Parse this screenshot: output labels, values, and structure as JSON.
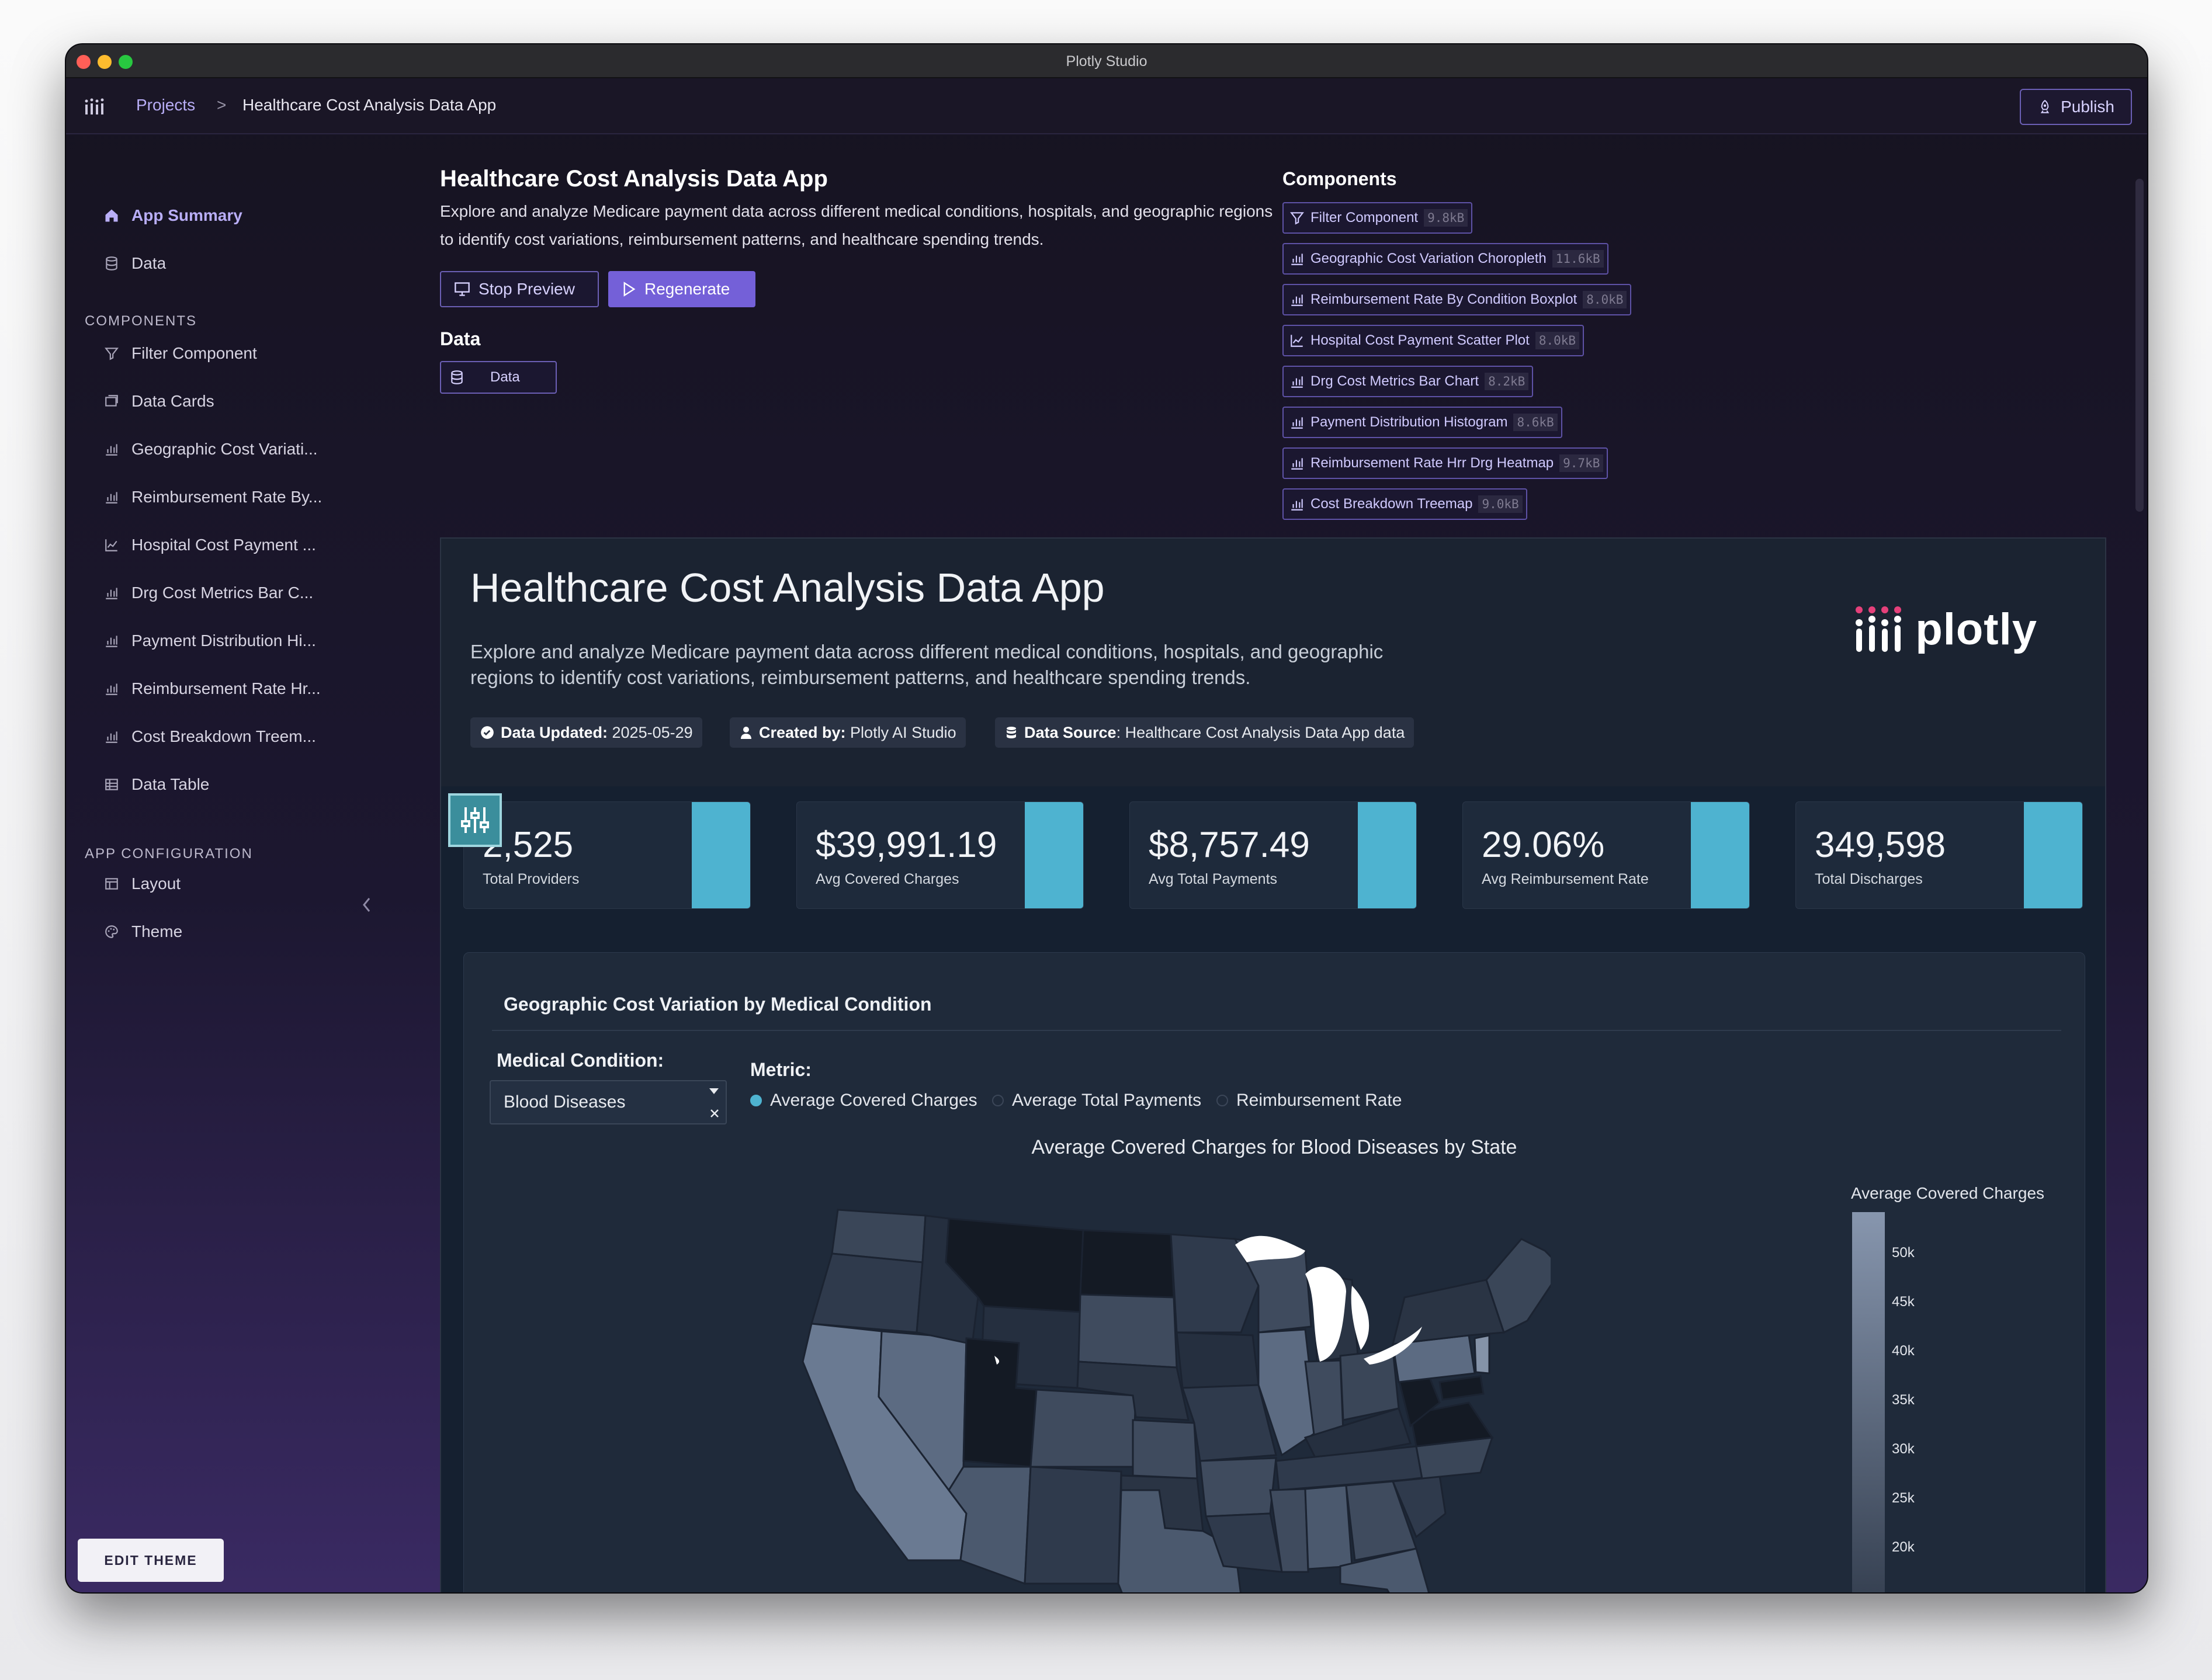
{
  "window": {
    "title": "Plotly Studio"
  },
  "nav": {
    "projects": "Projects",
    "separator": ">",
    "current": "Healthcare Cost Analysis Data App",
    "publish": "Publish"
  },
  "sidebar": {
    "app_summary": "App Summary",
    "data": "Data",
    "components_heading": "COMPONENTS",
    "components": [
      {
        "label": "Filter Component",
        "icon": "filter-icon"
      },
      {
        "label": "Data Cards",
        "icon": "cards-icon"
      },
      {
        "label": "Geographic Cost Variati...",
        "icon": "bar-chart-icon"
      },
      {
        "label": "Reimbursement Rate By...",
        "icon": "bar-chart-icon"
      },
      {
        "label": "Hospital Cost Payment ...",
        "icon": "line-chart-icon"
      },
      {
        "label": "Drg Cost Metrics Bar C...",
        "icon": "bar-chart-icon"
      },
      {
        "label": "Payment Distribution Hi...",
        "icon": "bar-chart-icon"
      },
      {
        "label": "Reimbursement Rate Hr...",
        "icon": "bar-chart-icon"
      },
      {
        "label": "Cost Breakdown Treem...",
        "icon": "bar-chart-icon"
      },
      {
        "label": "Data Table",
        "icon": "table-icon"
      }
    ],
    "config_heading": "APP CONFIGURATION",
    "layout": "Layout",
    "theme": "Theme",
    "edit_theme": "EDIT THEME"
  },
  "summary": {
    "title": "Healthcare Cost Analysis Data App",
    "description": "Explore and analyze Medicare payment data across different medical conditions, hospitals, and geographic regions to identify cost variations, reimbursement patterns, and healthcare spending trends.",
    "stop_preview": "Stop Preview",
    "regenerate": "Regenerate",
    "data_heading": "Data",
    "data_chip": "Data"
  },
  "components_panel": {
    "heading": "Components",
    "items": [
      {
        "label": "Filter Component",
        "size": "9.8kB",
        "icon": "filter-icon"
      },
      {
        "label": "Geographic Cost Variation Choropleth",
        "size": "11.6kB",
        "icon": "bar-chart-icon"
      },
      {
        "label": "Reimbursement Rate By Condition Boxplot",
        "size": "8.0kB",
        "icon": "bar-chart-icon"
      },
      {
        "label": "Hospital Cost Payment Scatter Plot",
        "size": "8.0kB",
        "icon": "line-chart-icon"
      },
      {
        "label": "Drg Cost Metrics Bar Chart",
        "size": "8.2kB",
        "icon": "bar-chart-icon"
      },
      {
        "label": "Payment Distribution Histogram",
        "size": "8.6kB",
        "icon": "bar-chart-icon"
      },
      {
        "label": "Reimbursement Rate Hrr Drg Heatmap",
        "size": "9.7kB",
        "icon": "bar-chart-icon"
      },
      {
        "label": "Cost Breakdown Treemap",
        "size": "9.0kB",
        "icon": "bar-chart-icon"
      }
    ]
  },
  "preview": {
    "title": "Healthcare Cost Analysis Data App",
    "description": "Explore and analyze Medicare payment data across different medical conditions, hospitals, and geographic regions to identify cost variations, reimbursement patterns, and healthcare spending trends.",
    "brand": "plotly",
    "badges": [
      {
        "key": "Data Updated:",
        "value": " 2025-05-29",
        "icon": "check-circle-icon"
      },
      {
        "key": "Created by:",
        "value": " Plotly AI Studio",
        "icon": "user-icon"
      },
      {
        "key": "Data Source",
        "value": ": Healthcare Cost Analysis Data App data",
        "icon": "database-icon"
      }
    ],
    "kpis": [
      {
        "value": "2,525",
        "label": "Total Providers"
      },
      {
        "value": "$39,991.19",
        "label": "Avg Covered Charges"
      },
      {
        "value": "$8,757.49",
        "label": "Avg Total Payments"
      },
      {
        "value": "29.06%",
        "label": "Avg Reimbursement Rate"
      },
      {
        "value": "349,598",
        "label": "Total Discharges"
      }
    ],
    "kpi_accent": "#4eb3d0",
    "geo_card": {
      "title": "Geographic Cost Variation by Medical Condition",
      "condition_label": "Medical Condition:",
      "condition_value": "Blood Diseases",
      "metric_label": "Metric:",
      "metrics": [
        {
          "label": "Average Covered Charges",
          "selected": true
        },
        {
          "label": "Average Total Payments",
          "selected": false
        },
        {
          "label": "Reimbursement Rate",
          "selected": false
        }
      ],
      "map_title": "Average Covered Charges for Blood Diseases by State",
      "colorbar_title": "Average Covered Charges",
      "colorbar_ticks": [
        "50k",
        "45k",
        "40k",
        "35k",
        "30k",
        "25k",
        "20k"
      ]
    }
  }
}
